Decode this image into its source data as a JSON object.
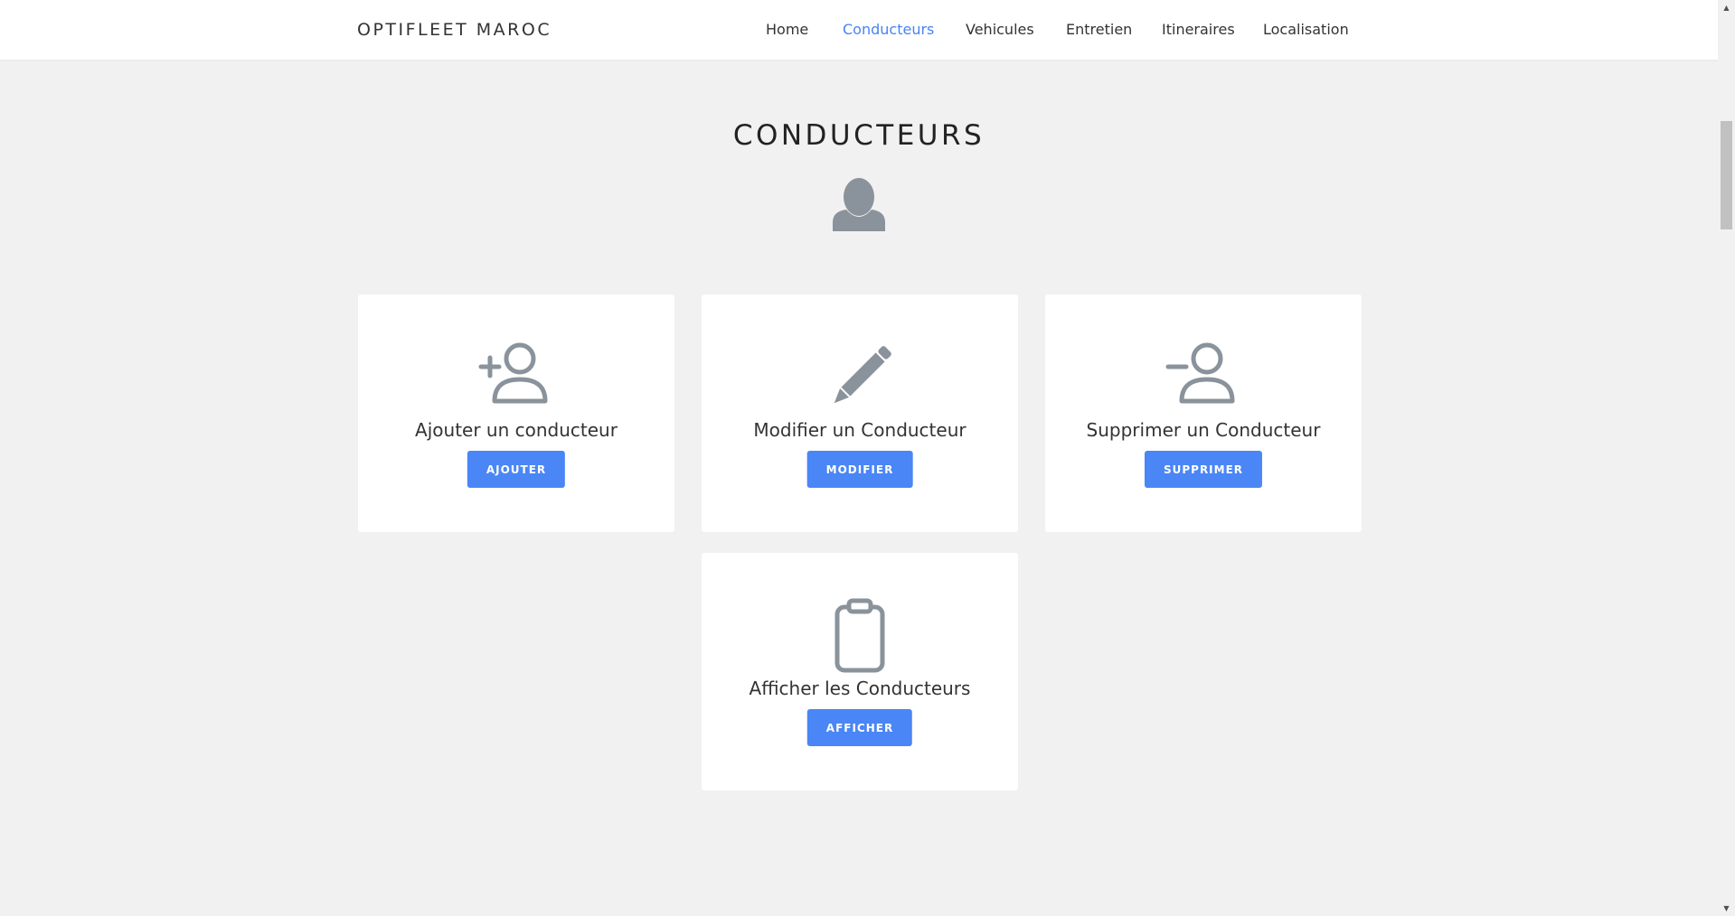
{
  "navbar": {
    "brand": "OPTIFLEET MAROC",
    "links": [
      {
        "label": "Home",
        "active": false
      },
      {
        "label": "Conducteurs",
        "active": true
      },
      {
        "label": "Vehicules",
        "active": false
      },
      {
        "label": "Entretien",
        "active": false
      },
      {
        "label": "Itineraires",
        "active": false
      },
      {
        "label": "Localisation",
        "active": false
      }
    ]
  },
  "header": {
    "title": "CONDUCTEURS",
    "icon": "user-silhouette-icon"
  },
  "cards": [
    {
      "icon": "user-add-icon",
      "title": "Ajouter un conducteur",
      "button": "AJOUTER"
    },
    {
      "icon": "pencil-icon",
      "title": "Modifier un Conducteur",
      "button": "MODIFIER"
    },
    {
      "icon": "user-remove-icon",
      "title": "Supprimer un Conducteur",
      "button": "SUPPRIMER"
    },
    {
      "icon": "clipboard-icon",
      "title": "Afficher les Conducteurs",
      "button": "AFFICHER"
    }
  ],
  "colors": {
    "accent": "#4a86f5",
    "nav_active": "#4784f3",
    "icon_gray": "#8a939b",
    "background": "#f1f1f1",
    "card": "#ffffff"
  }
}
